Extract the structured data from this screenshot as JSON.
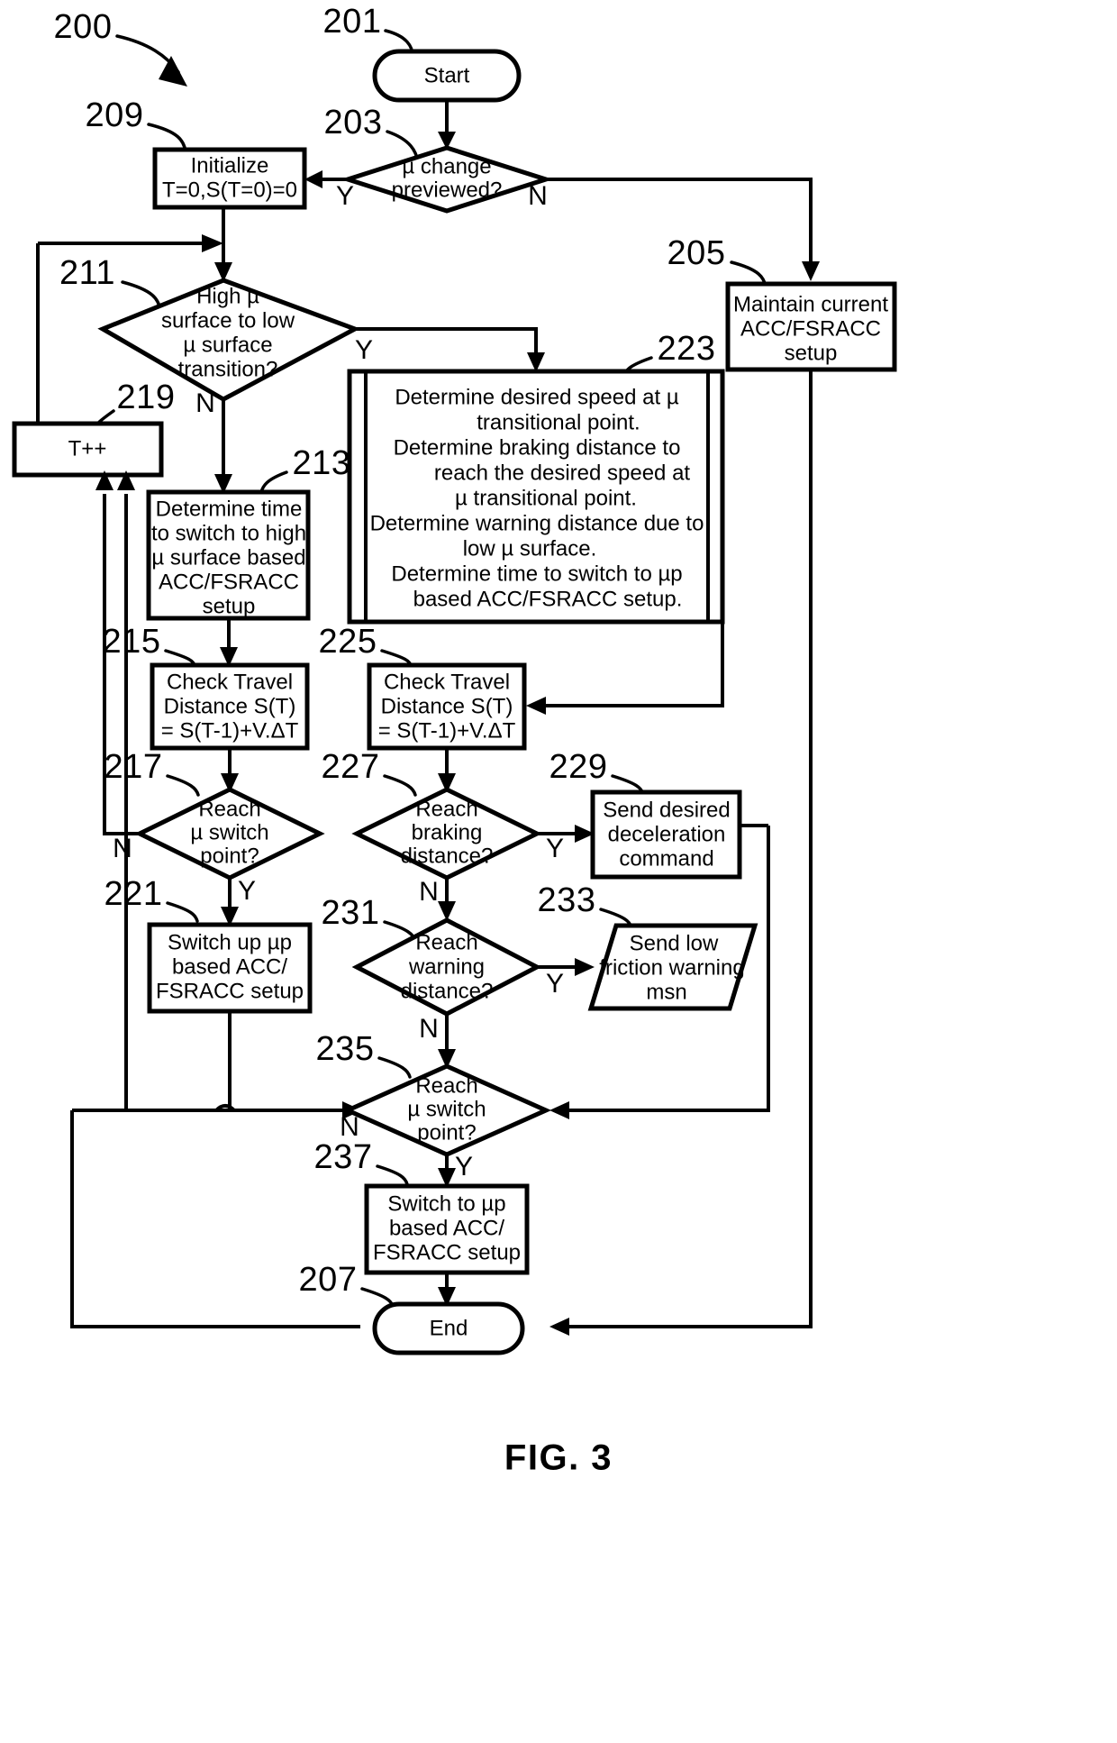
{
  "figure": {
    "caption": "FIG. 3",
    "diagram_ref": "200"
  },
  "nodes": {
    "start": {
      "ref": "201",
      "shape": "terminator",
      "lines": [
        "Start"
      ]
    },
    "mu_change_previewed": {
      "ref": "203",
      "shape": "decision",
      "lines": [
        "µ change",
        "previewed?"
      ],
      "yes": "Y",
      "no": "N"
    },
    "maintain_current": {
      "ref": "205",
      "shape": "process",
      "lines": [
        "Maintain current",
        "ACC/FSRACC",
        "setup"
      ]
    },
    "end": {
      "ref": "207",
      "shape": "terminator",
      "lines": [
        "End"
      ]
    },
    "initialize": {
      "ref": "209",
      "shape": "process",
      "lines": [
        "Initialize",
        "T=0,S(T=0)=0"
      ]
    },
    "high_low_transition": {
      "ref": "211",
      "shape": "decision",
      "lines": [
        "High µ",
        "surface to low",
        "µ surface",
        "transition?"
      ],
      "yes": "Y",
      "no": "N"
    },
    "determine_time_high": {
      "ref": "213",
      "shape": "process",
      "lines": [
        "Determine time",
        "to switch to high",
        "µ surface based",
        "ACC/FSRACC",
        "setup"
      ]
    },
    "check_travel_left": {
      "ref": "215",
      "shape": "process",
      "lines": [
        "Check Travel",
        "Distance S(T)",
        "= S(T-1)+V.ΔT"
      ]
    },
    "reach_mu_switch_left": {
      "ref": "217",
      "shape": "decision",
      "lines": [
        "Reach",
        "µ switch",
        "point?"
      ],
      "yes": "Y",
      "no": "N"
    },
    "t_increment": {
      "ref": "219",
      "shape": "process",
      "lines": [
        "T++"
      ]
    },
    "switch_up_mup": {
      "ref": "221",
      "shape": "process",
      "lines": [
        "Switch up µp",
        "based ACC/",
        "FSRACC setup"
      ]
    },
    "determine_block": {
      "ref": "223",
      "shape": "predefined",
      "lines": [
        "Determine desired speed at µ",
        "transitional point.",
        "Determine braking distance to",
        "reach the desired speed at",
        "µ transitional point.",
        "Determine warning distance due to",
        "low µ surface.",
        "Determine time to switch to µp",
        "based ACC/FSRACC setup."
      ]
    },
    "check_travel_right": {
      "ref": "225",
      "shape": "process",
      "lines": [
        "Check Travel",
        "Distance S(T)",
        "= S(T-1)+V.ΔT"
      ]
    },
    "reach_braking_distance": {
      "ref": "227",
      "shape": "decision",
      "lines": [
        "Reach",
        "braking",
        "distance?"
      ],
      "yes": "Y",
      "no": "N"
    },
    "send_decel_command": {
      "ref": "229",
      "shape": "process",
      "lines": [
        "Send desired",
        "deceleration",
        "command"
      ]
    },
    "reach_warning_distance": {
      "ref": "231",
      "shape": "decision",
      "lines": [
        "Reach",
        "warning",
        "distance?"
      ],
      "yes": "Y",
      "no": "N"
    },
    "send_low_friction_warning": {
      "ref": "233",
      "shape": "io-parallelogram",
      "lines": [
        "Send low",
        "friction warning",
        "msn"
      ]
    },
    "reach_mu_switch_right": {
      "ref": "235",
      "shape": "decision",
      "lines": [
        "Reach",
        "µ switch",
        "point?"
      ],
      "yes": "Y",
      "no": "N"
    },
    "switch_to_mup": {
      "ref": "237",
      "shape": "process",
      "lines": [
        "Switch to µp",
        "based ACC/",
        "FSRACC setup"
      ]
    }
  },
  "colors": {
    "stroke": "#000000",
    "fill": "#ffffff"
  }
}
